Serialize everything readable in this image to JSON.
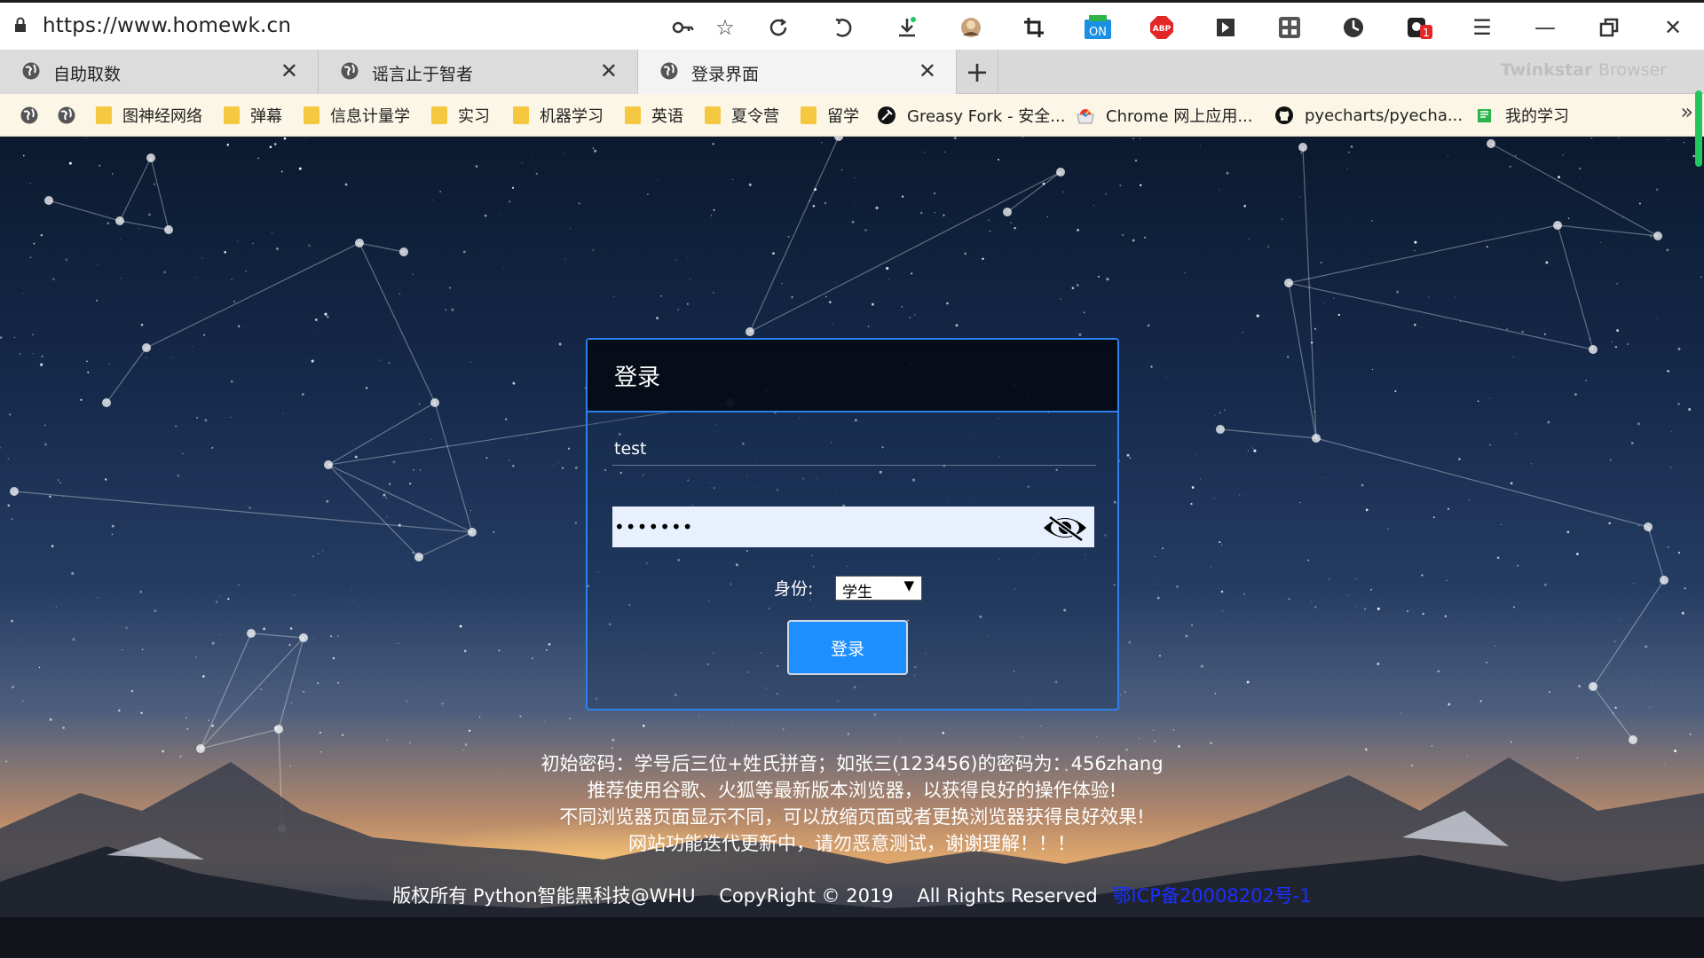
{
  "browser": {
    "url": "https://www.homewk.cn",
    "brand": {
      "name": "Twinkstar",
      "suffix": "Browser"
    },
    "toolbar_icons": [
      "key-icon",
      "star-icon",
      "refresh-icon",
      "undo-icon",
      "download-icon",
      "avatar-icon",
      "crop-icon",
      "on-toggle-icon",
      "abp-icon",
      "extension-icon",
      "qr-icon",
      "history-icon",
      "notification-icon",
      "menu-icon",
      "minimize-icon",
      "restore-icon",
      "close-window-icon"
    ],
    "on_badge": "ON",
    "abp_badge": "ABP",
    "notification_count": "1",
    "tabs": [
      {
        "title": "自助取数",
        "active": false
      },
      {
        "title": "谣言止于智者",
        "active": false
      },
      {
        "title": "登录界面",
        "active": true
      }
    ],
    "bookmarks": [
      {
        "label": "",
        "type": "globe"
      },
      {
        "label": "",
        "type": "globe"
      },
      {
        "label": "图神经网络",
        "type": "folder"
      },
      {
        "label": "弹幕",
        "type": "folder"
      },
      {
        "label": "信息计量学",
        "type": "folder"
      },
      {
        "label": "实习",
        "type": "folder"
      },
      {
        "label": "机器学习",
        "type": "folder"
      },
      {
        "label": "英语",
        "type": "folder"
      },
      {
        "label": "夏令营",
        "type": "folder"
      },
      {
        "label": "留学",
        "type": "folder"
      },
      {
        "label": "Greasy Fork - 安全...",
        "type": "site"
      },
      {
        "label": "Chrome 网上应用...",
        "type": "site"
      },
      {
        "label": "pyecharts/pyecha...",
        "type": "site"
      },
      {
        "label": "我的学习",
        "type": "site"
      }
    ],
    "colors": {
      "accent": "#2f80ed",
      "button": "#1e8fff",
      "folder": "#f5c842",
      "scroll": "#22c55e"
    }
  },
  "login": {
    "title": "登录",
    "username_value": "test",
    "password_value": "•••••••",
    "role_label": "身份:",
    "role_value": "学生",
    "submit_label": "登录"
  },
  "notes": [
    "初始密码：学号后三位+姓氏拼音；如张三(123456)的密码为：456zhang",
    "推荐使用谷歌、火狐等最新版本浏览器，以获得良好的操作体验!",
    "不同浏览器页面显示不同，可以放缩页面或者更换浏览器获得良好效果!",
    "网站功能迭代更新中，请勿恶意测试，谢谢理解！！！"
  ],
  "footer": {
    "copyright": "版权所有 Python智能黑科技@WHU    CopyRight © 2019    All Rights Reserved",
    "icp": "鄂ICP备20008202号-1"
  }
}
